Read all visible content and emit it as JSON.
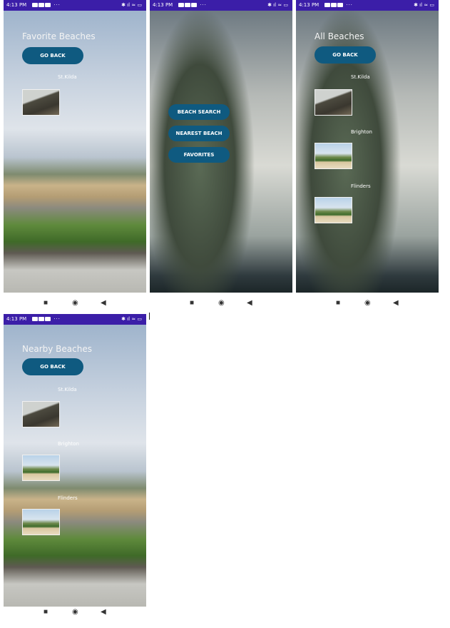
{
  "status_bar": {
    "time": "4:13 PM",
    "more": "···"
  },
  "screens": {
    "favorites": {
      "title": "Favorite Beaches",
      "back_button": "GO BACK",
      "beaches": [
        "St.Kilda"
      ]
    },
    "home": {
      "buttons": [
        "BEACH SEARCH",
        "NEAREST BEACH",
        "FAVORITES"
      ]
    },
    "all": {
      "title": "All Beaches",
      "back_button": "GO BACK",
      "beaches": [
        "St.Kilda",
        "Brighton",
        "Flinders"
      ]
    },
    "nearby": {
      "title": "Nearby Beaches",
      "back_button": "GO BACK",
      "beaches": [
        "St.Kilda",
        "Brighton",
        "Flinders"
      ]
    }
  },
  "nav": {
    "recents": "■",
    "home": "◉",
    "back": "◀"
  },
  "colors": {
    "status_bar": "#3b1ea8",
    "button": "#0f5a80"
  }
}
